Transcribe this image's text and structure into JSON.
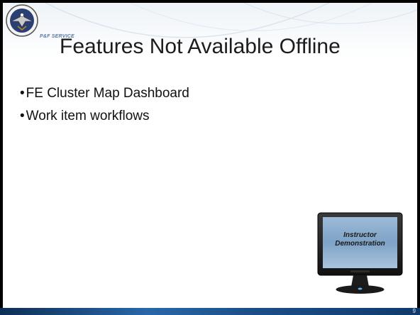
{
  "slide": {
    "seal_caption": "P&F SERVICE",
    "title": "Features Not Available Offline",
    "bullets": [
      "FE Cluster Map Dashboard",
      "Work item workflows"
    ],
    "bullet_symbol": "•",
    "page_number": "9"
  },
  "monitor": {
    "line1": "Instructor",
    "line2": "Demonstration"
  },
  "colors": {
    "frame": "#000000",
    "footer": "#1b4f88",
    "screen": "#7ea3c6"
  }
}
